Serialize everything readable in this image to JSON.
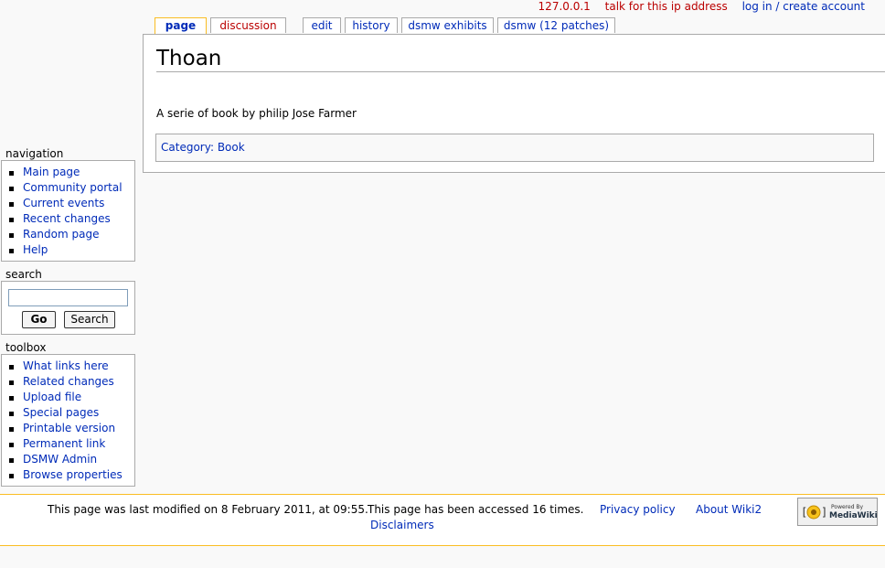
{
  "personal": {
    "ip": "127.0.0.1",
    "talk": "talk for this ip address",
    "login": "log in / create account"
  },
  "tabs": {
    "page": "page",
    "discussion": "discussion",
    "edit": "edit",
    "history": "history",
    "exhibits": "dsmw exhibits",
    "patches": "dsmw (12 patches)"
  },
  "content": {
    "title": "Thoan",
    "body": "A serie of book by philip Jose Farmer",
    "category_label": "Category",
    "category_sep": ":",
    "category_value": "Book"
  },
  "navigation": {
    "title": "navigation",
    "items": [
      "Main page",
      "Community portal",
      "Current events",
      "Recent changes",
      "Random page",
      "Help"
    ]
  },
  "search": {
    "title": "search",
    "value": "",
    "go": "Go",
    "search": "Search"
  },
  "toolbox": {
    "title": "toolbox",
    "items": [
      "What links here",
      "Related changes",
      "Upload file",
      "Special pages",
      "Printable version",
      "Permanent link",
      "DSMW Admin",
      "Browse properties"
    ]
  },
  "footer": {
    "lastmod": "This page was last modified on 8 February 2011, at 09:55.",
    "viewcount": "This page has been accessed 16 times.",
    "privacy": "Privacy policy",
    "about": "About Wiki2",
    "disclaimers": "Disclaimers",
    "powered_line1": "Powered By",
    "powered_line2": "MediaWiki"
  },
  "colors": {
    "link": "#002bb8",
    "newlink": "#ba0000",
    "tab_selected_border": "#fabd23",
    "border": "#aaaaaa"
  }
}
